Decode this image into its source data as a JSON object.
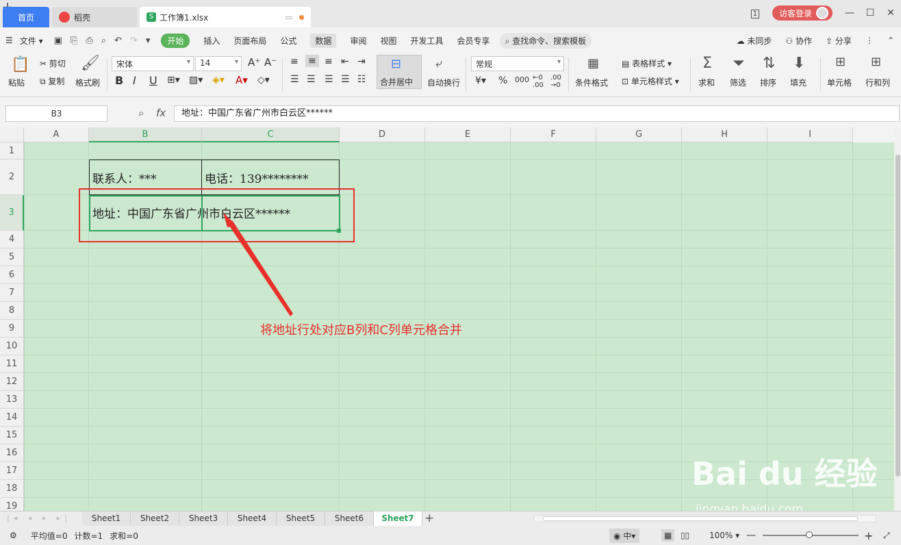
{
  "titlebar": {
    "tabs": [
      {
        "label": "首页"
      },
      {
        "label": "稻壳"
      },
      {
        "label": "工作簿1.xlsx"
      }
    ],
    "add_tab": "+",
    "login_label": "访客登录",
    "page_indicator": "1"
  },
  "menu": {
    "file": "文件",
    "items": [
      "开始",
      "插入",
      "页面布局",
      "公式",
      "数据",
      "审阅",
      "视图",
      "开发工具",
      "会员专享"
    ],
    "search": "查找命令、搜索模板",
    "right": [
      "未同步",
      "协作",
      "分享"
    ]
  },
  "ribbon": {
    "paste": "粘贴",
    "cut": "剪切",
    "copy": "复制",
    "format_painter": "格式刷",
    "font_name": "宋体",
    "font_size": "14",
    "merge": "合并居中",
    "wrap": "自动换行",
    "number_format": "常规",
    "conditional_format": "条件格式",
    "table_style": "表格样式",
    "cell_style": "单元格样式",
    "sum": "求和",
    "filter": "筛选",
    "sort": "排序",
    "fill": "填充",
    "cells": "单元格",
    "rows_cols": "行和列"
  },
  "formula_bar": {
    "name_box": "B3",
    "fx": "fx",
    "content": "地址：中国广东省广州市白云区******"
  },
  "grid": {
    "columns": [
      "A",
      "B",
      "C",
      "D",
      "E",
      "F",
      "G",
      "H",
      "I"
    ],
    "rows": [
      "1",
      "2",
      "3",
      "4",
      "5",
      "6",
      "7",
      "8",
      "9",
      "10",
      "11",
      "12",
      "13",
      "14",
      "15",
      "16",
      "17",
      "18",
      "19"
    ],
    "active_cell": "B3",
    "cells": {
      "B2": "联系人：***",
      "C2": "电话：139********",
      "B3": "地址：中国广东省广州市白云区******"
    }
  },
  "annotation": "将地址行处对应B列和C列单元格合并",
  "watermark": {
    "logo": "Bai du 经验",
    "url": "jingyan.baidu.com"
  },
  "sheets": [
    "Sheet1",
    "Sheet2",
    "Sheet3",
    "Sheet4",
    "Sheet5",
    "Sheet6",
    "Sheet7"
  ],
  "active_sheet": "Sheet7",
  "status": {
    "average": "平均值=0",
    "count": "计数=1",
    "sum": "求和=0",
    "zoom": "100%"
  },
  "colors": {
    "accent_green": "#2ea55e",
    "grid_bg": "#cce8cf",
    "annotation_red": "#e8302a",
    "home_tab": "#3d7ef2"
  }
}
